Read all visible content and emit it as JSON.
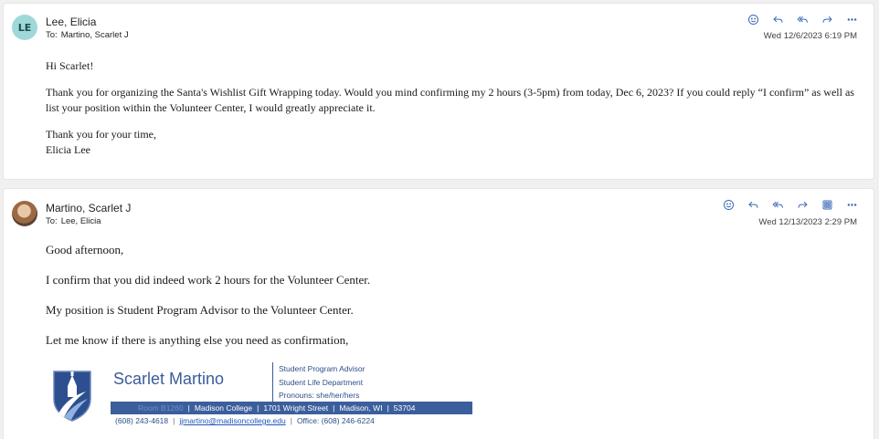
{
  "messages": [
    {
      "avatar_initials": "LE",
      "sender": "Lee, Elicia",
      "to_label": "To:",
      "to": "Martino, Scarlet J",
      "date": "Wed 12/6/2023 6:19 PM",
      "body": [
        "Hi Scarlet!",
        "Thank you for organizing the Santa's Wishlist Gift Wrapping today. Would you mind confirming my 2 hours (3-5pm) from today, Dec 6, 2023? If you could reply “I confirm” as well as list your position within the Volunteer Center, I would greatly appreciate it.",
        "Thank you for your time,",
        "Elicia Lee"
      ],
      "actions": [
        "emoji-icon",
        "reply-icon",
        "reply-all-icon",
        "forward-icon",
        "more-icon"
      ]
    },
    {
      "sender": "Martino, Scarlet J",
      "to_label": "To:",
      "to": "Lee, Elicia",
      "date": "Wed 12/13/2023 2:29 PM",
      "body": [
        "Good afternoon,",
        "I confirm that you did indeed work 2 hours for the Volunteer Center.",
        "My position is Student Program Advisor to the Volunteer Center.",
        "Let me know if there is anything else you need as confirmation,"
      ],
      "actions": [
        "emoji-icon",
        "reply-icon",
        "reply-all-icon",
        "forward-icon",
        "apps-icon",
        "more-icon"
      ],
      "signature": {
        "name": "Scarlet Martino",
        "title": "Student Program Advisor",
        "department": "Student Life Department",
        "pronouns": "Pronouns: she/her/hers",
        "room": "Room B1260",
        "college": "Madison College",
        "street": "1701 Wright Street",
        "city": "Madison, WI",
        "zip": "53704",
        "phone": "(608) 243-4618",
        "email": "jjmartino@madisoncollege.edu",
        "office": "Office: (608) 246-6224"
      }
    }
  ],
  "colors": {
    "accent": "#3a67b8",
    "signature_blue": "#3b5f9c",
    "initials_avatar": "#9fd8d8"
  }
}
